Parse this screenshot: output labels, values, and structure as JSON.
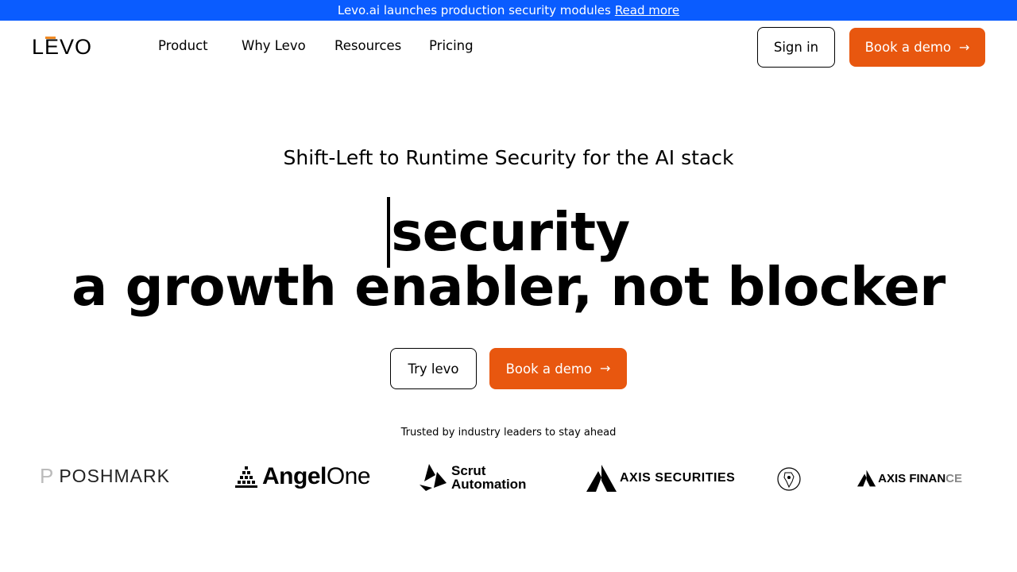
{
  "banner": {
    "text": "Levo.ai launches production security modules",
    "link": "Read more"
  },
  "nav": {
    "logo": "LEVO",
    "links": [
      "Product",
      "Why Levo",
      "Resources",
      "Pricing"
    ],
    "sign_in": "Sign in",
    "book_demo": "Book a demo"
  },
  "hero": {
    "subtitle": "Shift-Left to Runtime Security for the AI stack",
    "line1": "security",
    "line2": "a growth enabler, not blocker",
    "try_button": "Try levo",
    "demo_button": "Book a demo"
  },
  "trusted": {
    "caption": "Trusted by industry leaders to stay ahead",
    "logos": [
      {
        "name": "POSHMARK"
      },
      {
        "name_bold": "Angel",
        "name_light": "One"
      },
      {
        "line1": "Scrut",
        "line2": "Automation"
      },
      {
        "name": "AXIS SECURITIES"
      },
      {
        "name": "emblem"
      },
      {
        "name_a": "AXIS FINAN",
        "name_b": "CE"
      }
    ]
  },
  "colors": {
    "banner": "#0a5cff",
    "accent": "#e8570f",
    "logo_accent": "#f08a24"
  },
  "icons": {
    "arrow": "arrow-right-icon"
  }
}
